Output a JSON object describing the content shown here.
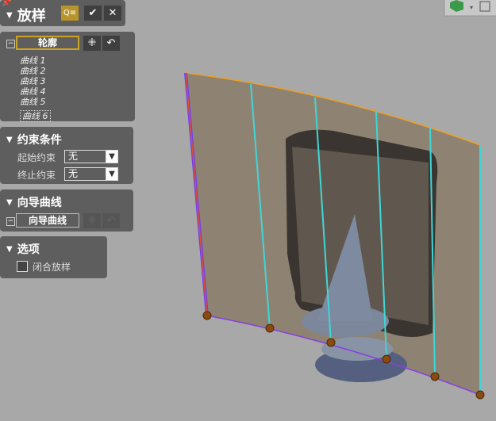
{
  "title": "放样",
  "toolbar": {
    "preview_icon": "preview-icon",
    "ok": "✔",
    "cancel": "✕"
  },
  "profile": {
    "label": "轮廓",
    "curves": [
      "曲线 1",
      "曲线 2",
      "曲线 3",
      "曲线 4",
      "曲线 5",
      "曲线 6"
    ]
  },
  "constraints": {
    "title": "约束条件",
    "start_label": "起始约束",
    "start_value": "无",
    "end_label": "终止约束",
    "end_value": "无"
  },
  "guide": {
    "title": "向导曲线",
    "label": "向导曲线"
  },
  "options": {
    "title": "选项",
    "closed_loft": "闭合放样",
    "closed_checked": false
  },
  "colors": {
    "panel": "#5e5e5e",
    "accent": "#c9a227",
    "surface": "#8a7c66",
    "curve": "#3fd6d6"
  }
}
